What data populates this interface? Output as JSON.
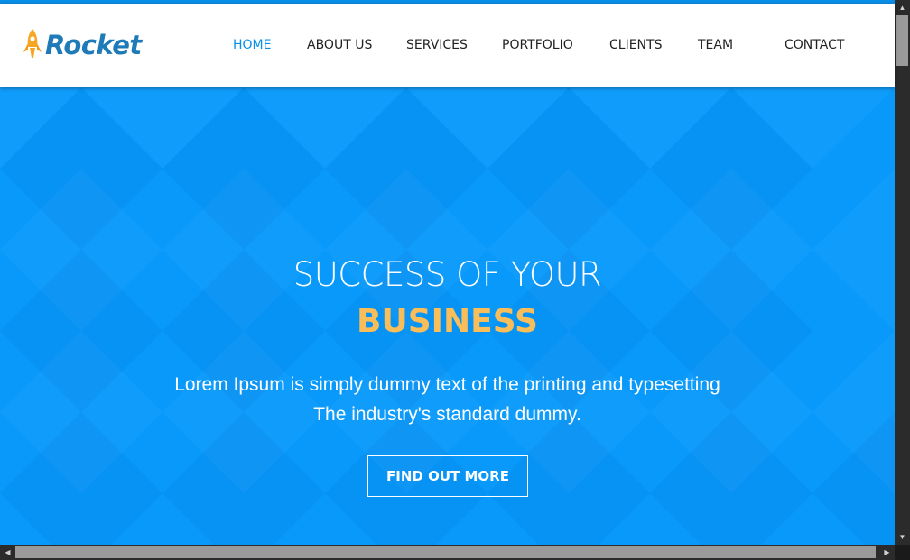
{
  "brand": {
    "name": "Rocket",
    "icon": "rocket-icon",
    "text_color": "#1e7bb8",
    "icon_color": "#f6a623"
  },
  "nav": {
    "items": [
      {
        "label": "HOME",
        "active": true
      },
      {
        "label": "ABOUT US",
        "active": false
      },
      {
        "label": "SERVICES",
        "active": false
      },
      {
        "label": "PORTFOLIO",
        "active": false
      },
      {
        "label": "CLIENTS",
        "active": false
      },
      {
        "label": "TEAM",
        "active": false
      },
      {
        "label": "CONTACT",
        "active": false
      }
    ],
    "active_color": "#0a8fe8"
  },
  "hero": {
    "title_line1": "SUCCESS OF YOUR",
    "title_line2": "BUSINESS",
    "subtitle_line1": "Lorem Ipsum is simply dummy text of the printing and typesetting",
    "subtitle_line2": "The industry's standard dummy.",
    "button_label": "FIND OUT MORE",
    "background_color": "#0899fb",
    "highlight_color": "#f9bd5a"
  },
  "scrollbars": {
    "up_arrow": "▲",
    "down_arrow": "▼",
    "left_arrow": "◀",
    "right_arrow": "▶"
  }
}
